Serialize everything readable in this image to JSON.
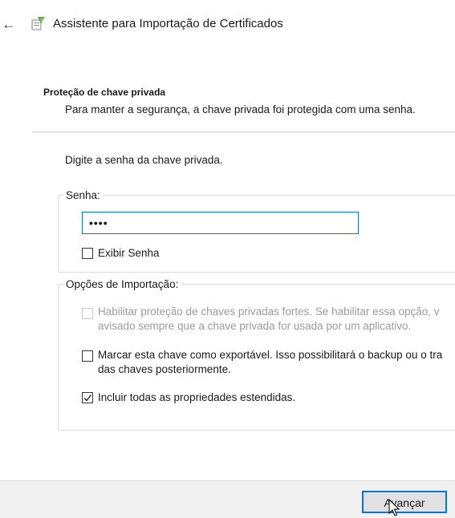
{
  "window": {
    "title": "Assistente para Importação de Certificados"
  },
  "section": {
    "heading": "Proteção de chave privada",
    "description": "Para manter a segurança, a chave privada foi protegida com uma senha."
  },
  "prompt": "Digite a senha da chave privada.",
  "password_group": {
    "legend": "Senha:",
    "value": "••••",
    "show_password": {
      "label": "Exibir Senha",
      "checked": false
    }
  },
  "import_options": {
    "legend": "Opções de Importação:",
    "options": [
      {
        "line1": "Habilitar proteção de chaves privadas fortes. Se habilitar essa opção, v",
        "line2": "avisado sempre que a chave privada for usada por um aplicativo.",
        "checked": false,
        "enabled": false
      },
      {
        "line1": "Marcar esta chave como exportável. Isso possibilitará o backup ou o tra",
        "line2": "das chaves posteriormente.",
        "checked": false,
        "enabled": true
      },
      {
        "line1": "Incluir todas as propriedades estendidas.",
        "checked": true,
        "enabled": true
      }
    ]
  },
  "buttons": {
    "next": "Avançar"
  },
  "icons": {
    "back": "back-arrow-icon",
    "app": "certificate-wizard-icon",
    "check": "checkmark-icon",
    "cursor": "mouse-pointer-icon"
  },
  "colors": {
    "focus_border": "#0a74d0",
    "disabled_text": "#9b9b9b",
    "footer_bg": "#f0f0f0"
  }
}
